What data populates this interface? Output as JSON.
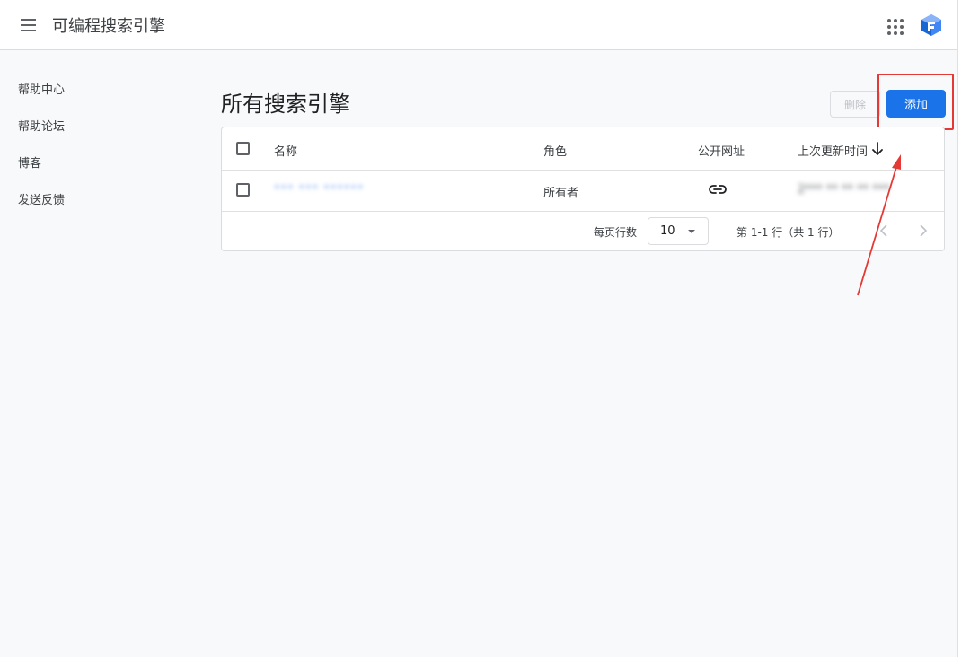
{
  "app": {
    "title": "可编程搜索引擎"
  },
  "sidebar": {
    "items": [
      {
        "label": "帮助中心"
      },
      {
        "label": "帮助论坛"
      },
      {
        "label": "博客"
      },
      {
        "label": "发送反馈"
      }
    ]
  },
  "main": {
    "title": "所有搜索引擎",
    "delete_label": "删除",
    "add_label": "添加"
  },
  "table": {
    "columns": {
      "name": "名称",
      "role": "角色",
      "public_url": "公开网址",
      "last_updated": "上次更新时间"
    },
    "rows": [
      {
        "name": "*** *** ******",
        "role": "所有者",
        "last_updated": "2*** ** ** ** ***"
      }
    ]
  },
  "pagination": {
    "rows_per_page_label": "每页行数",
    "rows_per_page_value": "10",
    "range_text": "第 1-1 行（共 1 行）"
  },
  "colors": {
    "accent": "#1a73e8",
    "annotation": "#e53935"
  },
  "icons": {
    "menu": "hamburger-icon",
    "apps": "apps-grid-icon",
    "logo": "cse-logo-icon",
    "sort": "arrow-down-icon",
    "link": "link-icon",
    "dropdown": "caret-down-icon",
    "prev": "chevron-left-icon",
    "next": "chevron-right-icon"
  }
}
